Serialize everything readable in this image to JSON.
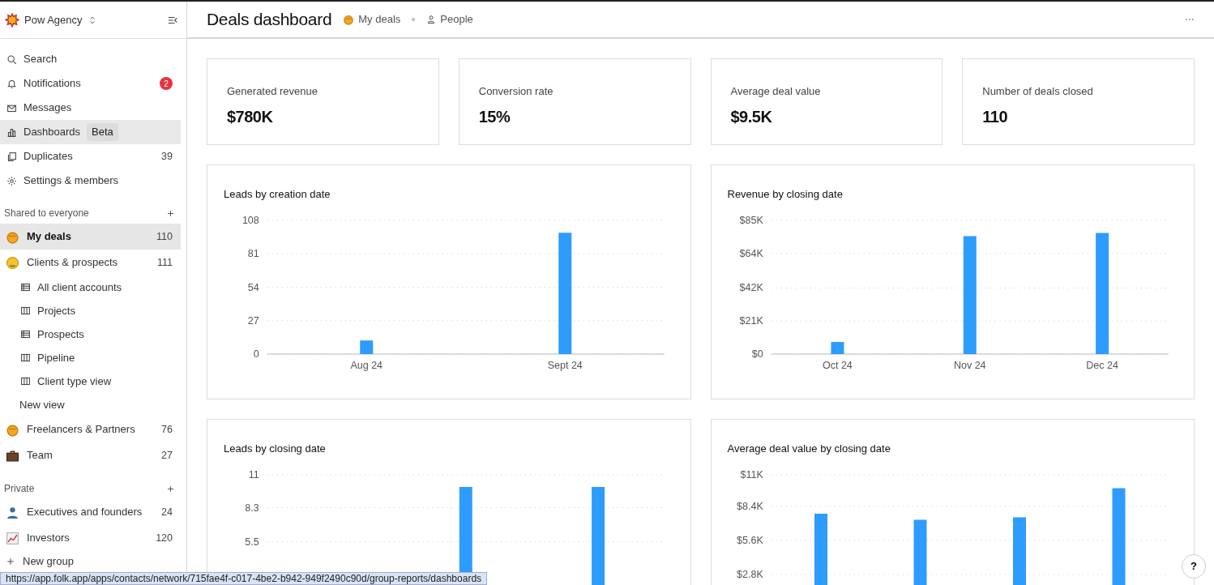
{
  "workspace": {
    "name": "Pow Agency"
  },
  "nav": [
    {
      "label": "Search",
      "hovered": false
    },
    {
      "label": "Notifications",
      "badge": "2",
      "hovered": false
    },
    {
      "label": "Messages",
      "hovered": false
    },
    {
      "label": "Dashboards",
      "tag": "Beta",
      "hovered": true
    },
    {
      "label": "Duplicates",
      "count": "39",
      "hovered": false
    },
    {
      "label": "Settings & members",
      "hovered": false
    }
  ],
  "sections": [
    {
      "title": "Shared to everyone",
      "groups": [
        {
          "label": "My deals",
          "count": "110",
          "selected": true
        },
        {
          "label": "Clients & prospects",
          "count": "111",
          "selected": false,
          "children": [
            {
              "label": "All client accounts",
              "kind": "table"
            },
            {
              "label": "Projects",
              "kind": "board"
            },
            {
              "label": "Prospects",
              "kind": "table"
            },
            {
              "label": "Pipeline",
              "kind": "board"
            },
            {
              "label": "Client type view",
              "kind": "board"
            },
            {
              "label": "New view",
              "kind": "add"
            }
          ]
        },
        {
          "label": "Freelancers & Partners",
          "count": "76",
          "selected": false
        },
        {
          "label": "Team",
          "count": "27",
          "selected": false
        }
      ]
    },
    {
      "title": "Private",
      "groups": [
        {
          "label": "Executives and founders",
          "count": "24",
          "selected": false
        },
        {
          "label": "Investors",
          "count": "120",
          "selected": false
        },
        {
          "label": "New group",
          "kind": "add",
          "selected": false
        }
      ]
    }
  ],
  "header": {
    "title": "Deals dashboard",
    "breadcrumbs": [
      {
        "label": "My deals"
      },
      {
        "label": "People"
      }
    ]
  },
  "stats": [
    {
      "label": "Generated revenue",
      "value": "$780K"
    },
    {
      "label": "Conversion rate",
      "value": "15%"
    },
    {
      "label": "Average deal value",
      "value": "$9.5K"
    },
    {
      "label": "Number of deals closed",
      "value": "110"
    }
  ],
  "charts": [
    {
      "title": "Leads by creation date",
      "chart_data": {
        "type": "bar",
        "grid": true,
        "categories": [
          "Aug 24",
          "Sept 24"
        ],
        "series": [
          {
            "color": "#2e9bff",
            "values": [
              11,
              98
            ]
          }
        ],
        "ylim": [
          0,
          108
        ],
        "yticks": [
          0,
          27,
          54,
          81,
          108
        ]
      }
    },
    {
      "title": "Revenue by closing date",
      "chart_data": {
        "type": "bar",
        "grid": true,
        "categories": [
          "Oct 24",
          "Nov 24",
          "Dec 24"
        ],
        "series": [
          {
            "color": "#2e9bff",
            "values": [
              7700,
              75000,
              77000
            ]
          }
        ],
        "ylim": [
          0,
          85000
        ],
        "yticks": [
          {
            "value": 0,
            "label": "$0"
          },
          {
            "value": 21000,
            "label": "$21K"
          },
          {
            "value": 42000,
            "label": "$42K"
          },
          {
            "value": 64000,
            "label": "$64K"
          },
          {
            "value": 85000,
            "label": "$85K"
          }
        ]
      }
    },
    {
      "title": "Leads by closing date",
      "chart_data": {
        "type": "bar",
        "grid": true,
        "series": [
          {
            "color": "#2e9bff",
            "values": [
              null,
              10,
              10
            ]
          }
        ],
        "ylim": [
          0,
          11
        ],
        "yticks": [
          5.5,
          8.3,
          11
        ]
      }
    },
    {
      "title": "Average deal value by closing date",
      "chart_data": {
        "type": "bar",
        "grid": true,
        "series": [
          {
            "color": "#2e9bff",
            "values": [
              7800,
              7300,
              7500,
              9900
            ]
          }
        ],
        "ylim": [
          0,
          11000
        ],
        "yticks": [
          {
            "value": 2800,
            "label": "$2.8K"
          },
          {
            "value": 5600,
            "label": "$5.6K"
          },
          {
            "value": 8400,
            "label": "$8.4K"
          },
          {
            "value": 11000,
            "label": "$11K"
          }
        ]
      }
    }
  ],
  "help": {
    "label": "?"
  },
  "status_url": "https://app.folk.app/apps/contacts/network/715fae4f-c017-4be2-b942-949f2490c90d/group-reports/dashboards"
}
